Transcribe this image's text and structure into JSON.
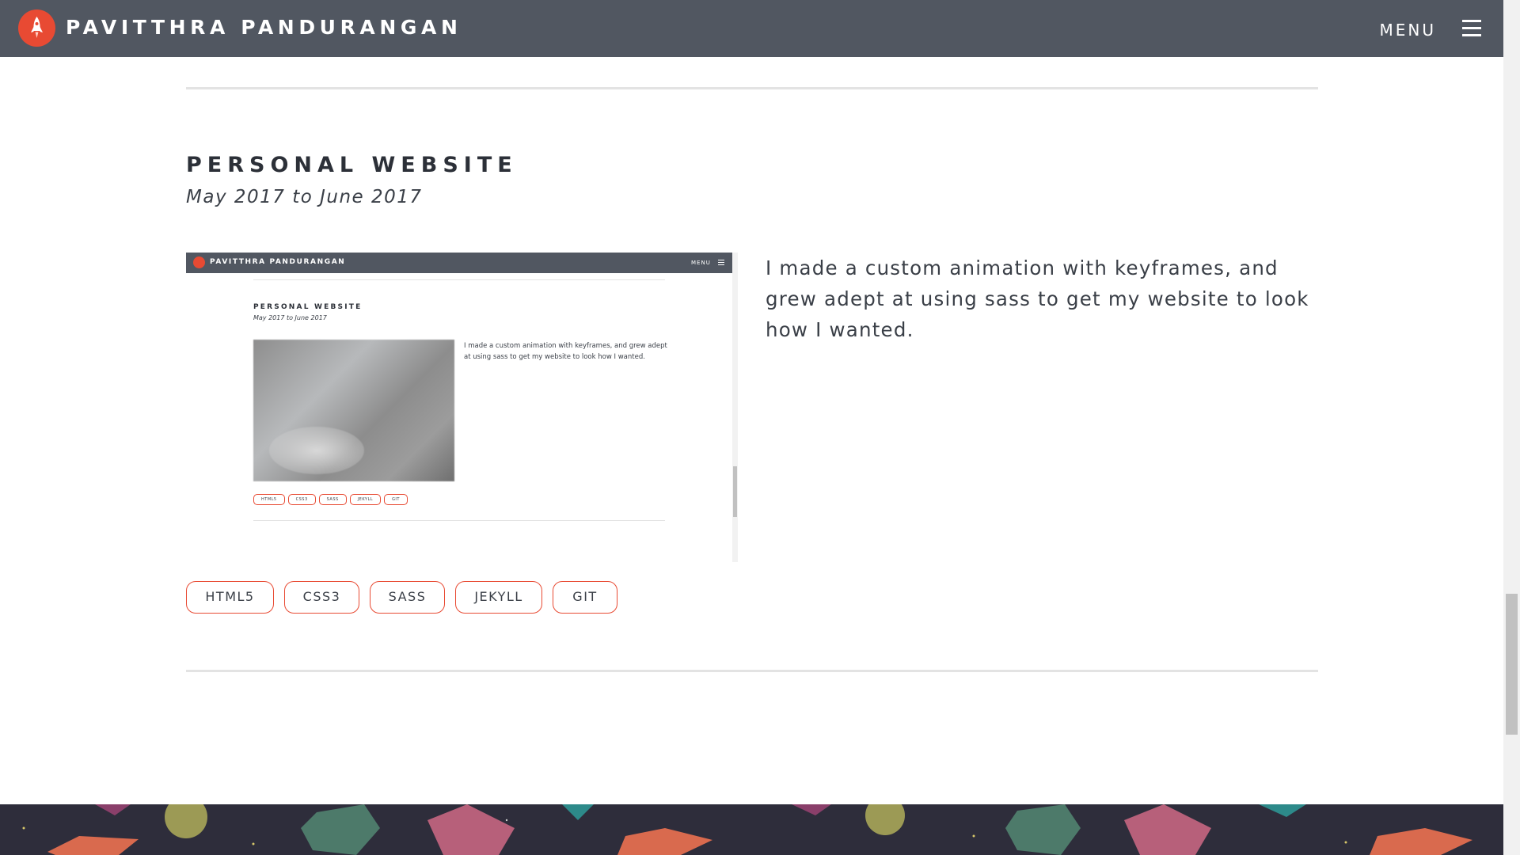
{
  "header": {
    "brand": "PAVITTHRA PANDURANGAN",
    "menu_label": "MENU"
  },
  "project": {
    "title": "PERSONAL WEBSITE",
    "dates": "May 2017 to June 2017",
    "description": "I made a custom animation with keyframes, and grew adept at using sass to get my website to look how I wanted.",
    "tags": [
      "HTML5",
      "CSS3",
      "SASS",
      "JEKYLL",
      "GIT"
    ]
  },
  "preview": {
    "brand": "PAVITTHRA PANDURANGAN",
    "menu_label": "MENU",
    "title": "PERSONAL WEBSITE",
    "dates": "May 2017 to June 2017",
    "description": "I made a custom animation with keyframes, and grew adept at using sass to get my website to look how I wanted.",
    "tags": [
      "HTML5",
      "CSS3",
      "SASS",
      "JEKYLL",
      "GIT"
    ]
  },
  "colors": {
    "navbar": "#515761",
    "accent": "#e84a33",
    "footer": "#2e2d3b"
  },
  "icons": {
    "logo": "rocket-icon",
    "menu": "hamburger-menu-icon"
  }
}
